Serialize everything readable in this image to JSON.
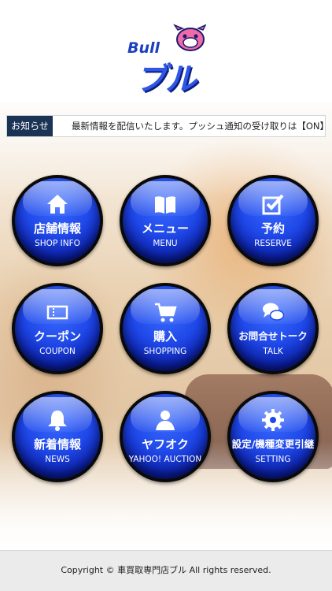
{
  "header": {
    "logo_bull": "Bull",
    "logo_main": "ブル"
  },
  "notice": {
    "label": "お知らせ",
    "text": "最新情報を配信いたします。プッシュ通知の受け取りは【ON】でご設定ください。"
  },
  "menu": [
    {
      "jp": "店舗情報",
      "en": "SHOP INFO",
      "icon": "house-icon"
    },
    {
      "jp": "メニュー",
      "en": "MENU",
      "icon": "book-icon"
    },
    {
      "jp": "予約",
      "en": "RESERVE",
      "icon": "checkbox-icon"
    },
    {
      "jp": "クーポン",
      "en": "COUPON",
      "icon": "ticket-icon"
    },
    {
      "jp": "購入",
      "en": "SHOPPING",
      "icon": "cart-icon"
    },
    {
      "jp": "お問合せトーク",
      "en": "TALK",
      "icon": "chat-bubbles-icon"
    },
    {
      "jp": "新着情報",
      "en": "NEWS",
      "icon": "bell-icon"
    },
    {
      "jp": "ヤフオク",
      "en": "YAHOO! AUCTION",
      "icon": "person-icon"
    },
    {
      "jp": "設定/機種変更引継",
      "en": "SETTING",
      "icon": "gear-icon"
    }
  ],
  "footer": {
    "copyright": "Copyright © 車買取専門店ブル All rights reserved."
  },
  "colors": {
    "notice_label_bg": "#1b3354",
    "button_blue": "#1f48e8",
    "footer_bg": "#ebebeb"
  }
}
